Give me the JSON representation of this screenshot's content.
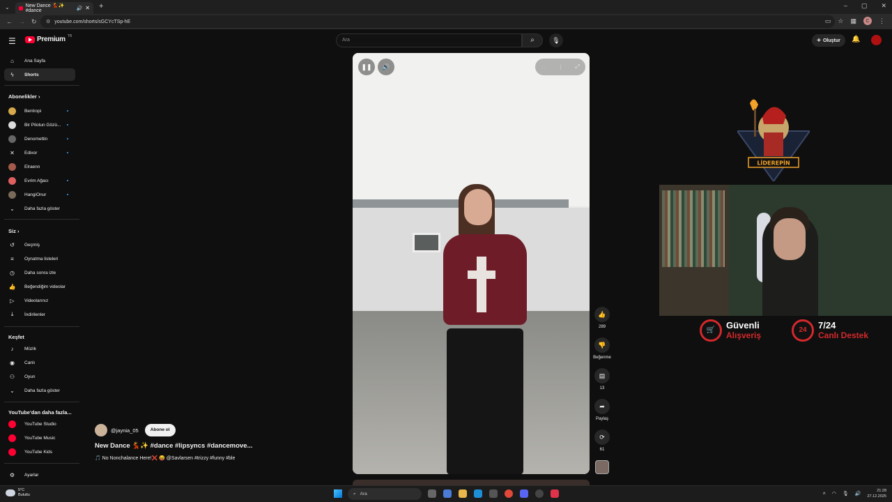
{
  "browser": {
    "tab_title": "New Dance 💃✨ #dance",
    "url": "youtube.com/shorts/sGCYcTSp-hE",
    "new_tab": "+",
    "window_controls": [
      "–",
      "▢",
      "✕"
    ]
  },
  "masthead": {
    "logo_text": "Premium",
    "logo_suffix": "TR",
    "search_placeholder": "Ara",
    "create_label": "Oluştur"
  },
  "sidebar": {
    "main": [
      {
        "label": "Ana Sayfa",
        "icon": "home-icon",
        "active": false
      },
      {
        "label": "Shorts",
        "icon": "shorts-icon",
        "active": true
      }
    ],
    "subscriptions_header": "Abonelikler",
    "subscriptions": [
      {
        "label": "Bentropi",
        "color": "#d7a94a"
      },
      {
        "label": "Bir Pilotun Gözü...",
        "color": "#dddddd"
      },
      {
        "label": "Denomettin",
        "color": "#666666"
      },
      {
        "label": "Edixor",
        "color": "#222222"
      },
      {
        "label": "Elraenn",
        "color": "#a35a4a"
      },
      {
        "label": "Evrim Ağacı",
        "color": "#e06060"
      },
      {
        "label": "HangiOnur",
        "color": "#7a6a5a"
      }
    ],
    "subs_more": "Daha fazla göster",
    "you_header": "Siz",
    "you": [
      {
        "label": "Geçmiş",
        "icon": "history-icon"
      },
      {
        "label": "Oynatma listeleri",
        "icon": "playlist-icon"
      },
      {
        "label": "Daha sonra izle",
        "icon": "watch-later-icon"
      },
      {
        "label": "Beğendiğim videolar",
        "icon": "like-icon"
      },
      {
        "label": "Videolarınız",
        "icon": "video-icon"
      },
      {
        "label": "İndirilenler",
        "icon": "download-icon"
      }
    ],
    "explore_header": "Keşfet",
    "explore": [
      {
        "label": "Müzik",
        "icon": "music-icon"
      },
      {
        "label": "Canlı",
        "icon": "live-icon"
      },
      {
        "label": "Oyun",
        "icon": "gaming-icon"
      }
    ],
    "explore_more": "Daha fazla göster",
    "more_header": "YouTube'dan daha fazla...",
    "more": [
      {
        "label": "YouTube Studio"
      },
      {
        "label": "YouTube Music"
      },
      {
        "label": "YouTube Kids"
      }
    ],
    "settings": "Ayarlar"
  },
  "short": {
    "channel": "@jaynia_05",
    "subscribe_label": "Abone ol",
    "title": "New Dance 💃✨ #dance #lipsyncs #dancemove...",
    "description": "🎵 No Nonchalance Here!❌ 😝 @Savlarsen #trizzy #funny #ble"
  },
  "actions": {
    "like_count": "289",
    "dislike_label": "Beğenme",
    "comment_count": "13",
    "share_label": "Paylaş",
    "remix_count": "61"
  },
  "overlay": {
    "logo_text": "LİDEREPİN",
    "promo1_line1": "Güvenli",
    "promo1_line2": "Alışveriş",
    "promo2_badge": "24",
    "promo2_line1": "7/24",
    "promo2_line2": "Canlı Destek"
  },
  "taskbar": {
    "temp": "5°C",
    "weather": "Bulutlu",
    "search_placeholder": "Ara",
    "time": "21:28",
    "date": "27.12.2025"
  }
}
